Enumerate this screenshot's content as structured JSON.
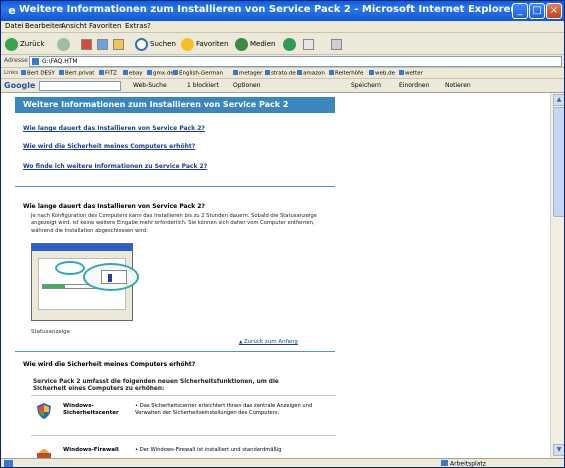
{
  "window": {
    "title": "Weitere Informationen zum Installieren von Service Pack 2 - Microsoft Internet Explorer"
  },
  "menu": [
    "Datei",
    "Bearbeiten",
    "Ansicht",
    "Favoriten",
    "Extras",
    "?"
  ],
  "toolbar": {
    "back": "Zurück",
    "search": "Suchen",
    "favorites": "Favoriten",
    "media": "Medien"
  },
  "address": {
    "label": "Adresse",
    "value": "G:\\FAQ.HTM"
  },
  "links": {
    "label": "Links",
    "items": [
      "Bert DESY",
      "Bert privat",
      "FITZ",
      "ebay",
      "gmx.de",
      "English-German",
      "metager",
      "strato.de",
      "amazon",
      "Reiterhöfe",
      "web.de",
      "wetter"
    ]
  },
  "google": {
    "logo": "Google",
    "web_search": "Web-Suche",
    "blocked": "1 blockiert",
    "options": "Optionen",
    "save": "Speichern",
    "sort": "Einordnen",
    "notes": "Notieren"
  },
  "page": {
    "banner": "Weitere Informationen zum Installieren von Service Pack 2",
    "toc": [
      "Wie lange dauert das Installieren von Service Pack 2?",
      "Wie wird die Sicherheit meines Computers erhöht?",
      "Wo finde ich weitere Informationen zu Service Pack 2?"
    ],
    "q1_heading": "Wie lange dauert das Installieren von Service Pack 2?",
    "q1_text": "Je nach Konfiguration des Computers kann das Installieren bis zu 2 Stunden dauern. Sobald die Statusanzeige angezeigt wird, ist keine weitere Eingabe mehr erforderlich. Sie können sich daher vom Computer entfernen, während die Installation abgeschlossen wird.",
    "wizard_progress": 0.28,
    "caption": "Statusanzeige",
    "back_to_top": "Zurück zum Anfang",
    "q2_heading": "Wie wird die Sicherheit meines Computers erhöht?",
    "q2_subhead": "Service Pack 2 umfasst die folgenden neuen Sicherheitsfunktionen, um die Sicherheit eines Computers zu erhöhen:",
    "features": [
      {
        "name": "Windows-Sicherheitscenter",
        "desc": "Das Sicherheitscenter erleichtert Ihnen das zentrale Anzeigen und Verwalten der Sicherheitseinstellungen des Computers."
      },
      {
        "name": "Windows-Firewall",
        "desc": "Der Windows-Firewall ist installiert und standardmäßig"
      }
    ]
  },
  "status": {
    "zone": "Arbeitsplatz"
  }
}
